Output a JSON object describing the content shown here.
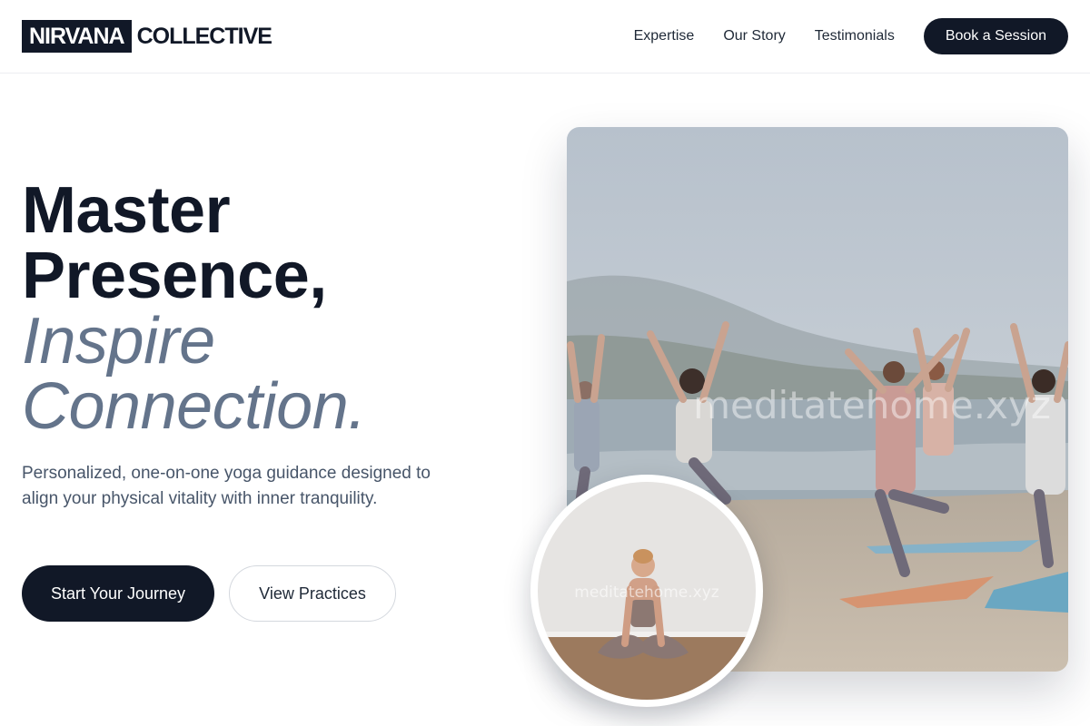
{
  "brand": {
    "logo_box": "NIRVANA",
    "logo_rest": "COLLECTIVE"
  },
  "nav": {
    "links": [
      "Expertise",
      "Our Story",
      "Testimonials"
    ],
    "cta": "Book a Session"
  },
  "hero": {
    "title_line1": "Master",
    "title_line2": "Presence,",
    "title_line3": "Inspire",
    "title_line4": "Connection.",
    "subtitle": "Personalized, one-on-one yoga guidance designed to align your physical vitality with inner tranquility.",
    "primary_button": "Start Your Journey",
    "secondary_button": "View Practices"
  },
  "images": {
    "main_watermark": "meditatehome.xyz",
    "avatar_watermark": "meditatehome.xyz"
  },
  "colors": {
    "primary": "#111827",
    "muted_heading": "#64748b",
    "body_text": "#475569"
  }
}
